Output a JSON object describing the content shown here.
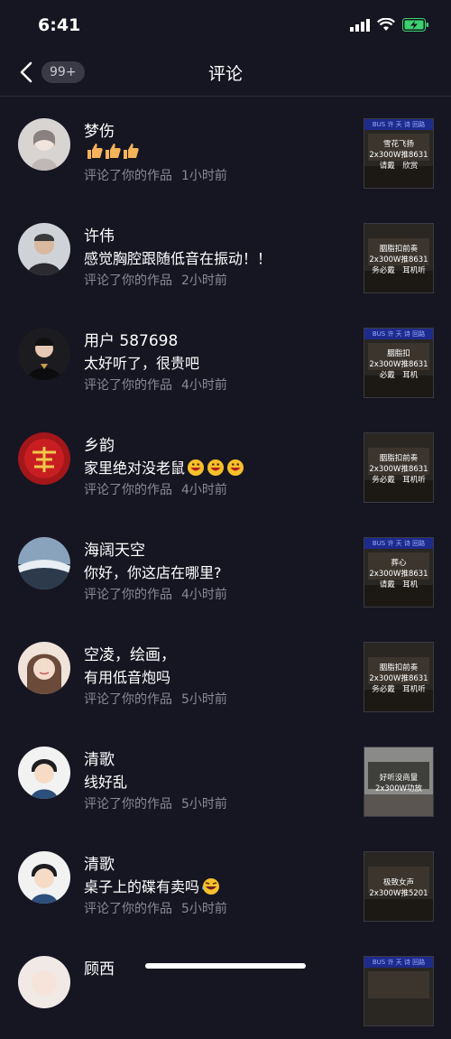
{
  "status": {
    "time": "6:41"
  },
  "nav": {
    "badge": "99+",
    "title": "评论"
  },
  "colors": {
    "background": "#161622",
    "meta": "#8a8a96",
    "thumb_banner": "#1e2a8c"
  },
  "comments": [
    {
      "name": "梦伤",
      "content": "",
      "emoji": "thumbs-up x3",
      "action": "评论了你的作品",
      "time": "1小时前",
      "thumb": {
        "banner": "BUS 许 天 诗 回路",
        "text": "雪花飞扬\n2x300W推8631\n请戴　欣赏"
      }
    },
    {
      "name": "许伟",
      "content": "感觉胸腔跟随低音在振动！！",
      "action": "评论了你的作品",
      "time": "2小时前",
      "thumb": {
        "banner": "",
        "text": "胭脂扣前奏\n2x300W推8631\n务必戴　耳机听"
      }
    },
    {
      "name": "用户 587698",
      "content": "太好听了，很贵吧",
      "action": "评论了你的作品",
      "time": "4小时前",
      "thumb": {
        "banner": "BUS 许 天 诗 回路",
        "text": "胭脂扣\n2x300W推8631\n必戴　耳机"
      }
    },
    {
      "name": "乡韵",
      "content": "家里绝对没老鼠",
      "emoji": "grinning x3",
      "action": "评论了你的作品",
      "time": "4小时前",
      "thumb": {
        "banner": "",
        "text": "胭脂扣前奏\n2x300W推8631\n务必戴　耳机听"
      }
    },
    {
      "name": "海阔天空",
      "content": "你好，你这店在哪里?",
      "action": "评论了你的作品",
      "time": "4小时前",
      "thumb": {
        "banner": "BUS 许 天 诗 回路",
        "text": "葬心\n2x300W推8631\n请戴　耳机"
      }
    },
    {
      "name": "空凌，绘画，",
      "content": "有用低音炮吗",
      "action": "评论了你的作品",
      "time": "5小时前",
      "thumb": {
        "banner": "",
        "text": "胭脂扣前奏\n2x300W推8631\n务必戴　耳机听"
      }
    },
    {
      "name": "清歌",
      "content": "线好乱",
      "action": "评论了你的作品",
      "time": "5小时前",
      "thumb": {
        "banner": "",
        "text": "好听没商量\n2x300W功放"
      }
    },
    {
      "name": "清歌",
      "content": "桌子上的碟有卖吗",
      "emoji": "laughing x1",
      "action": "评论了你的作品",
      "time": "5小时前",
      "thumb": {
        "banner": "",
        "text": "极致女声\n2x300W推5201"
      }
    },
    {
      "name": "顾西",
      "content": "",
      "action": "",
      "time": "",
      "thumb": {
        "banner": "BUS 许 天 诗 回路",
        "text": ""
      }
    }
  ]
}
